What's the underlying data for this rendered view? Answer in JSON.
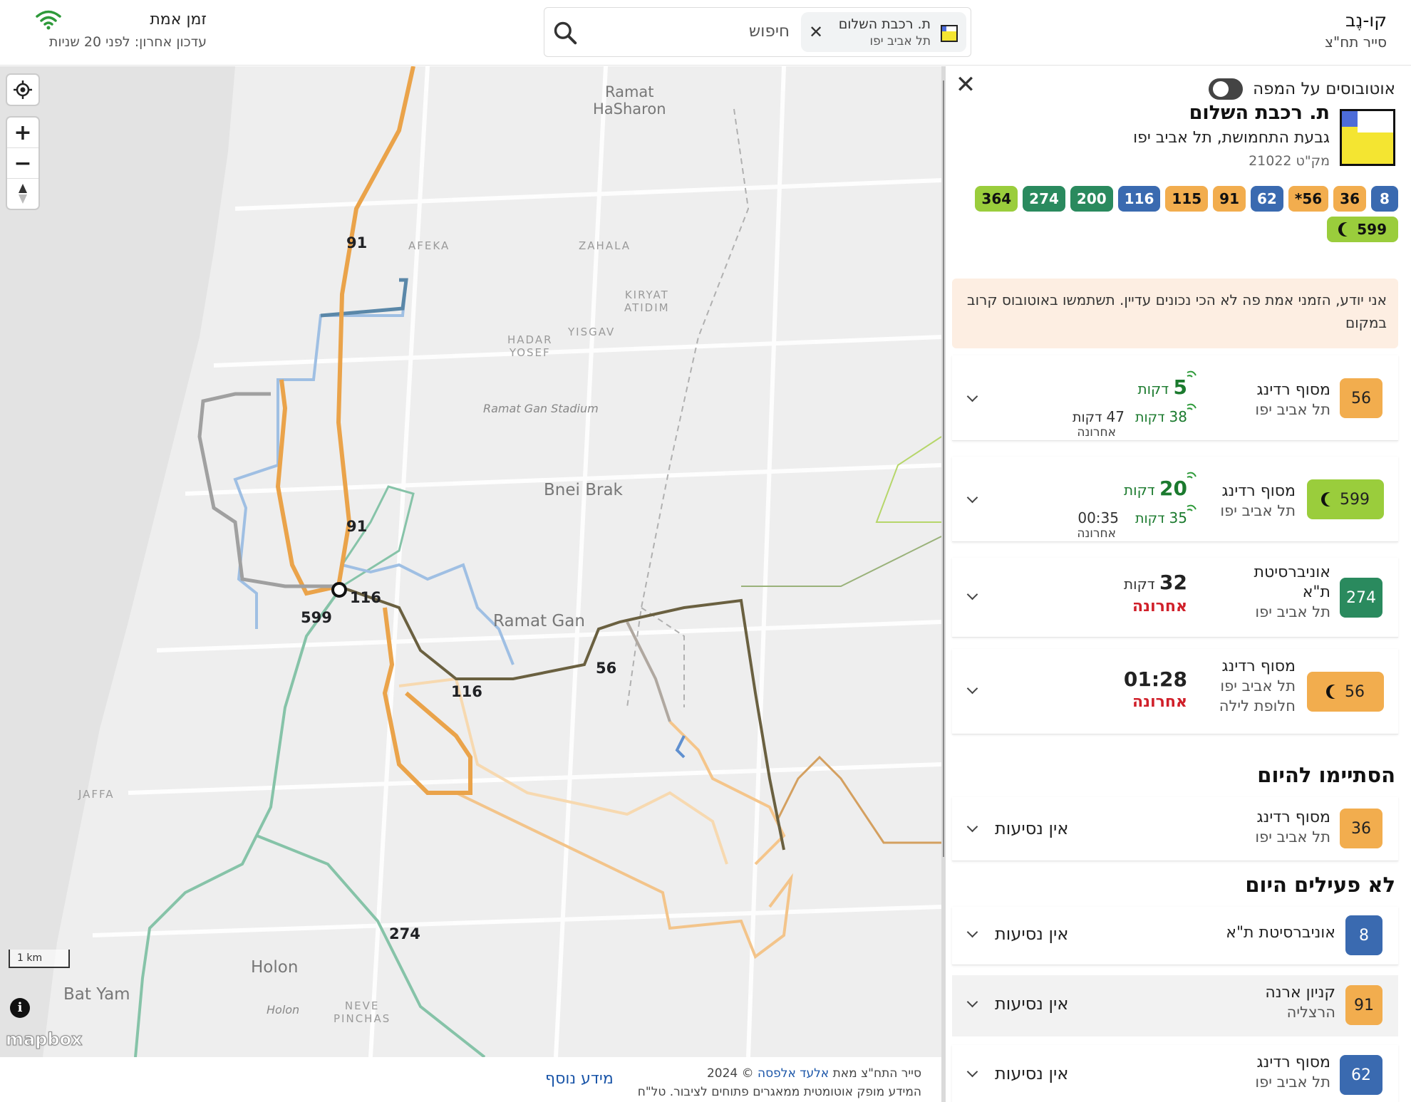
{
  "brand": {
    "name": "קו-נֶב",
    "subtitle": "סייר תח\"צ"
  },
  "search": {
    "placeholder": "חיפוש",
    "chip": {
      "title": "ת. רכבת השלום",
      "city": "תל אביב יפו",
      "close": "✕"
    }
  },
  "realtime": {
    "label": "זמן אמת",
    "updated": "עדכון אחרון: לפני 20 שניות"
  },
  "map": {
    "controls": {
      "locate": "locate-icon",
      "zoom_in": "+",
      "zoom_out": "−",
      "compass": "compass-icon"
    },
    "scale": "1 km",
    "attribution_logo": "mapbox",
    "places": [
      {
        "id": "ramat-hasharon",
        "text": "Ramat\nHaSharon"
      },
      {
        "id": "afeka",
        "text": "AFEKA"
      },
      {
        "id": "zahala",
        "text": "ZAHALA"
      },
      {
        "id": "kiryat-atidim",
        "text": "KIRYAT\nATIDIM"
      },
      {
        "id": "hadar-yosef",
        "text": "HADAR\nYOSEF"
      },
      {
        "id": "yisgav",
        "text": "YISGAV"
      },
      {
        "id": "stadium",
        "text": "Ramat Gan Stadium"
      },
      {
        "id": "bnei-brak",
        "text": "Bnei Brak"
      },
      {
        "id": "ramat-gan",
        "text": "Ramat Gan"
      },
      {
        "id": "jaffa",
        "text": "JAFFA"
      },
      {
        "id": "holon",
        "text": "Holon"
      },
      {
        "id": "holon-small",
        "text": "Holon"
      },
      {
        "id": "bat-yam",
        "text": "Bat Yam"
      },
      {
        "id": "neve-pinchas",
        "text": "NEVE\nPINCHAS"
      }
    ],
    "route_labels": [
      {
        "id": "r91a",
        "text": "91",
        "color": "#e8a33a"
      },
      {
        "id": "r91b",
        "text": "91",
        "color": "#e8a33a"
      },
      {
        "id": "r116a",
        "text": "116",
        "color": "#8fb3e0"
      },
      {
        "id": "r116b",
        "text": "116",
        "color": "#8fb3e0"
      },
      {
        "id": "r599",
        "text": "599",
        "color": "#555566"
      },
      {
        "id": "r56",
        "text": "56",
        "color": "#8a6a2a"
      },
      {
        "id": "r274",
        "text": "274",
        "color": "#7fbfa4"
      }
    ]
  },
  "panel": {
    "close": "✕",
    "toggle_label": "אוטובוסים על המפה",
    "stop": {
      "name": "ת. רכבת השלום",
      "area": "גבעת התחמושת, תל אביב יפו",
      "code": "מק\"ט 21022"
    },
    "chips": [
      {
        "label": "8",
        "color": "#3a6ab0",
        "light": true
      },
      {
        "label": "36",
        "color": "#f2ad4e",
        "light": false
      },
      {
        "label": "56*",
        "color": "#f2ad4e",
        "light": false
      },
      {
        "label": "62",
        "color": "#3a6ab0",
        "light": true
      },
      {
        "label": "91",
        "color": "#f2ad4e",
        "light": false
      },
      {
        "label": "115",
        "color": "#f2ad4e",
        "light": false
      },
      {
        "label": "116",
        "color": "#3a6ab0",
        "light": true
      },
      {
        "label": "200",
        "color": "#2a8a5e",
        "light": true
      },
      {
        "label": "274",
        "color": "#2a8a5e",
        "light": true
      },
      {
        "label": "364",
        "color": "#9acd3c",
        "light": false
      },
      {
        "label": "599",
        "color": "#9acd3c",
        "light": false,
        "night": true
      }
    ],
    "notice": "אני יודע, הזמני אמת פה לא הכי נכונים עדיין. תשתמשו באוטובוס קרוב במקום",
    "arrivals": [
      {
        "line": "56",
        "color": "#f2ad4e",
        "dest": "מסוף רדינג",
        "city": "תל אביב יפו",
        "eta_num": "5",
        "eta_unit": "דקות",
        "next_num": "38",
        "next_unit": "דקות",
        "last_num": "47",
        "last_unit": "דקות",
        "last_caption": "אחרונה"
      },
      {
        "line": "599",
        "color": "#9acd3c",
        "night": true,
        "dest": "מסוף רדינג",
        "city": "תל אביב יפו",
        "eta_num": "20",
        "eta_unit": "דקות",
        "next_num": "35",
        "next_unit": "דקות",
        "last_time": "00:35",
        "last_caption": "אחרונה"
      },
      {
        "line": "274",
        "color": "#2a8a5e",
        "light": true,
        "dest": "אוניברסיטת",
        "dest2": "ת\"א",
        "city": "תל אביב יפו",
        "eta_num": "32",
        "eta_unit": "דקות",
        "last_flag": "אחרונה"
      },
      {
        "line": "56",
        "color": "#f2ad4e",
        "night": true,
        "dest": "מסוף רדינג",
        "city": "תל אביב יפו",
        "sub": "חלופת לילה",
        "time": "01:28",
        "last_flag": "אחרונה"
      }
    ],
    "finished_title": "הסתיימו להיום",
    "finished": [
      {
        "line": "36",
        "color": "#f2ad4e",
        "dest": "מסוף רדינג",
        "city": "תל אביב יפו",
        "status": "אין נסיעות"
      }
    ],
    "inactive_title": "לא פעילים היום",
    "inactive": [
      {
        "line": "8",
        "color": "#3a6ab0",
        "light": true,
        "dest": "אוניברסיטת ת\"א",
        "status": "אין נסיעות"
      },
      {
        "line": "91",
        "color": "#f2ad4e",
        "dest": "קניון ארנה",
        "city": "הרצליה",
        "status": "אין נסיעות"
      },
      {
        "line": "62",
        "color": "#3a6ab0",
        "light": true,
        "dest": "מסוף רדינג",
        "city": "תל אביב יפו",
        "status": "אין נסיעות"
      }
    ]
  },
  "footer": {
    "credit_pre": "סייר התח\"צ מאת",
    "credit_author": "אלעד אלפסה",
    "credit_post": "© 2024",
    "line2": "המידע מופק אוטומטית ממאגרים פתוחים לציבור. טל\"ח",
    "more": "מידע נוסף"
  }
}
